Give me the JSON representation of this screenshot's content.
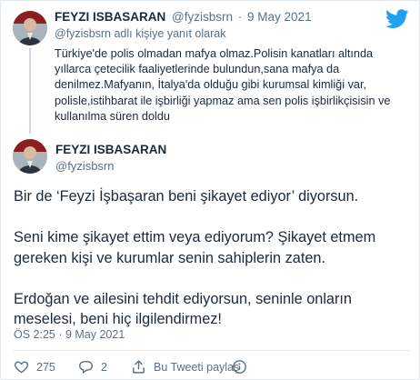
{
  "parent_tweet": {
    "name": "FEYZI ISBASARAN",
    "handle": "@fyzisbsrn",
    "separator": "·",
    "date": "9 May 2021",
    "reply_context": "@fyzisbsrn adlı kişiye yanıt olarak",
    "text": "Türkiye'de polis olmadan mafya olmaz.Polisin kanatları altında yıllarca çetecilik faaliyetlerinde bulundun,sana mafya da denilmez.Mafyanın, İtalya'da olduğu gibi kurumsal kimliği var, polisle,istihbarat ile işbirliği yapmaz ama sen polis işbirlikçisisin ve kullanılma süren doldu"
  },
  "main_tweet": {
    "name": "FEYZI ISBASARAN",
    "handle": "@fyzisbsrn",
    "paragraphs": [
      "Bir de ‘Feyzi İşbaşaran beni şikayet ediyor’ diyorsun.",
      "Seni kime şikayet ettim veya ediyorum? Şikayet etmem gereken kişi ve kurumlar senin sahiplerin zaten.",
      "Erdoğan ve ailesini tehdit ediyorsun, seninle onların meselesi, beni hiç ilgilendirmez!"
    ],
    "timestamp": "ÖS 2:25 · 9 May 2021"
  },
  "actions": {
    "likes": "275",
    "replies": "2",
    "share_label": "Bu Tweeti paylaş"
  },
  "icons": {
    "brand": "twitter-bird-icon",
    "like": "heart-icon",
    "reply": "comment-icon",
    "share": "share-icon",
    "info": "info-icon"
  },
  "colors": {
    "brand_blue": "#1da1f2",
    "secondary_text": "#5b7083",
    "primary_text": "#1c2938"
  }
}
